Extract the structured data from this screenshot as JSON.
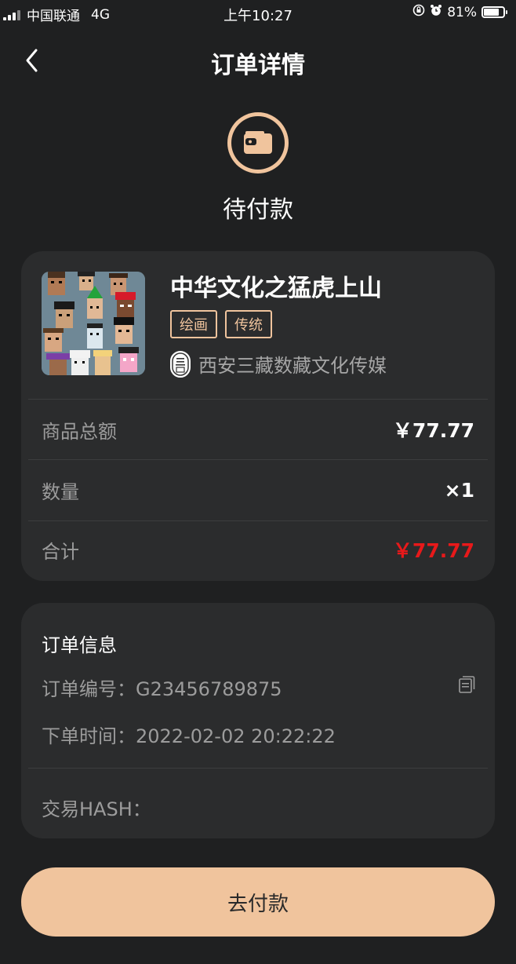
{
  "status_bar": {
    "carrier": "中国联通",
    "network": "4G",
    "time": "上午10:27",
    "battery": "81%",
    "battery_level": 0.81
  },
  "header": {
    "title": "订单详情"
  },
  "order_status": {
    "icon": "wallet-icon",
    "text": "待付款",
    "accent_color": "#f0c49d"
  },
  "product": {
    "title": "中华文化之猛虎上山",
    "tags": [
      "绘画",
      "传统"
    ],
    "creator": "西安三藏数藏文化传媒",
    "creator_logo_text": "三藏"
  },
  "summary": {
    "rows": [
      {
        "label": "商品总额",
        "value": "￥77.77"
      },
      {
        "label": "数量",
        "value": "×1"
      },
      {
        "label": "合计",
        "value": "￥77.77"
      }
    ],
    "total_color": "#e8191a"
  },
  "order_info": {
    "title": "订单信息",
    "order_no_label": "订单编号：",
    "order_no": "G23456789875",
    "time_label": "下单时间：",
    "time": "2022-02-02 20:22:22",
    "hash_label": "交易HASH："
  },
  "actions": {
    "pay_label": "去付款"
  }
}
